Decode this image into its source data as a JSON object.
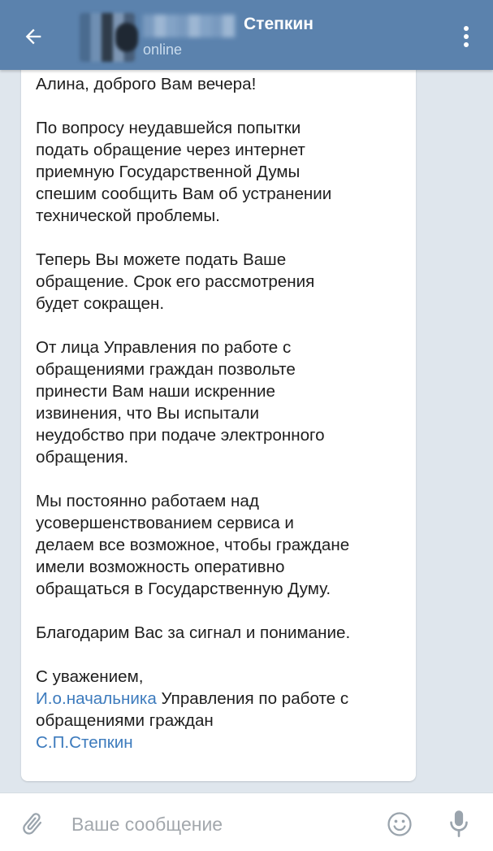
{
  "header": {
    "chat_name": "Степкин",
    "status": "online"
  },
  "message": {
    "greeting": "Алина, доброго Вам вечера!",
    "p1": [
      "По вопросу неудавшейся попытки",
      "подать обращение через интернет",
      "приемную Государственной Думы",
      "спешим сообщить Вам об устранении",
      "технической проблемы."
    ],
    "p2": [
      "Теперь Вы можете подать Ваше",
      "обращение. Срок его рассмотрения",
      "будет сокращен."
    ],
    "p3": [
      "От лица Управления по работе с",
      "обращениями граждан позвольте",
      "принести Вам наши искренние",
      "извинения, что Вы испытали",
      "неудобство при подаче электронного",
      "обращения."
    ],
    "p4": [
      "Мы постоянно работаем над",
      "усовершенствованием сервиса и",
      "делаем все возможное, чтобы граждане",
      "имели возможность оперативно",
      "обращаться в Государственную Думу."
    ],
    "p5": "Благодарим Вас за сигнал и понимание.",
    "signature": {
      "regards": "С уважением,",
      "link_title": "И.о.начальника",
      "title_rest": " Управления по работе с",
      "title_line2": "обращениями граждан",
      "link_name": "С.П.Степкин"
    }
  },
  "input": {
    "placeholder": "Ваше сообщение"
  },
  "icons": {
    "back": "arrow-left-icon",
    "menu": "more-vertical-icon",
    "attach": "paperclip-icon",
    "emoji": "smiley-icon",
    "mic": "microphone-icon"
  },
  "colors": {
    "header": "#5b82ad",
    "background": "#dfe6ed",
    "link": "#3d7bbd",
    "icon_gray": "#9aa4ad"
  }
}
